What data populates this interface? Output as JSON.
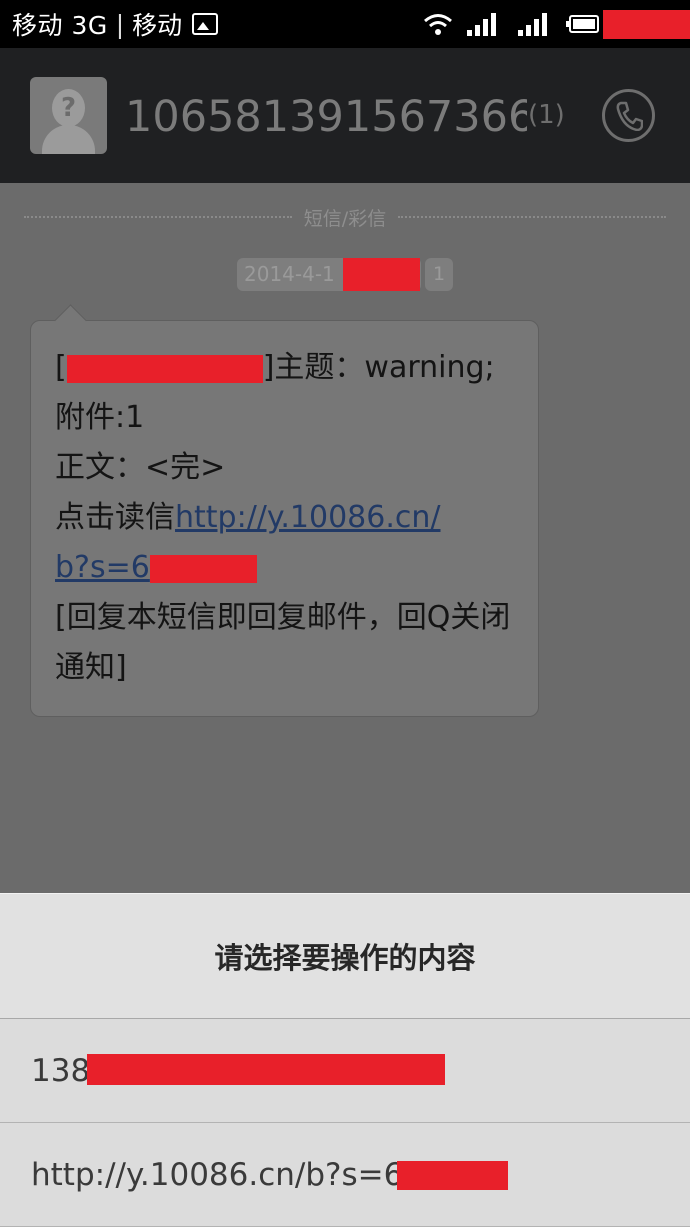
{
  "status_bar": {
    "carrier_1": "移动 3G",
    "separator": "|",
    "carrier_2": "移动",
    "icons": [
      "image-notification-icon",
      "wifi-icon",
      "signal-icon",
      "signal-icon",
      "battery-icon"
    ]
  },
  "header": {
    "contact_name": "106581391567366",
    "message_count": "(1)",
    "icons": [
      "avatar-placeholder-icon",
      "phone-icon"
    ]
  },
  "conversation": {
    "type_label": "短信/彩信",
    "date": "2014-4-1",
    "count": "1",
    "message": {
      "subject_prefix": "[",
      "subject_suffix": "]主题：warning;",
      "attachment": "附件:1",
      "body": "正文：<完>",
      "read_prefix": "点击读信",
      "link_line1": "http://y.10086.cn/",
      "link_line2": "b?s=6",
      "footer": "[回复本短信即回复邮件，回Q关闭通知]"
    }
  },
  "dialog": {
    "title": "请选择要操作的内容",
    "items": [
      "138",
      "http://y.10086.cn/b?s=6"
    ]
  },
  "colors": {
    "redaction": "#e8202a",
    "link": "#223a66",
    "header_bg": "#1f2022",
    "dialog_bg": "#dcdcdc"
  }
}
